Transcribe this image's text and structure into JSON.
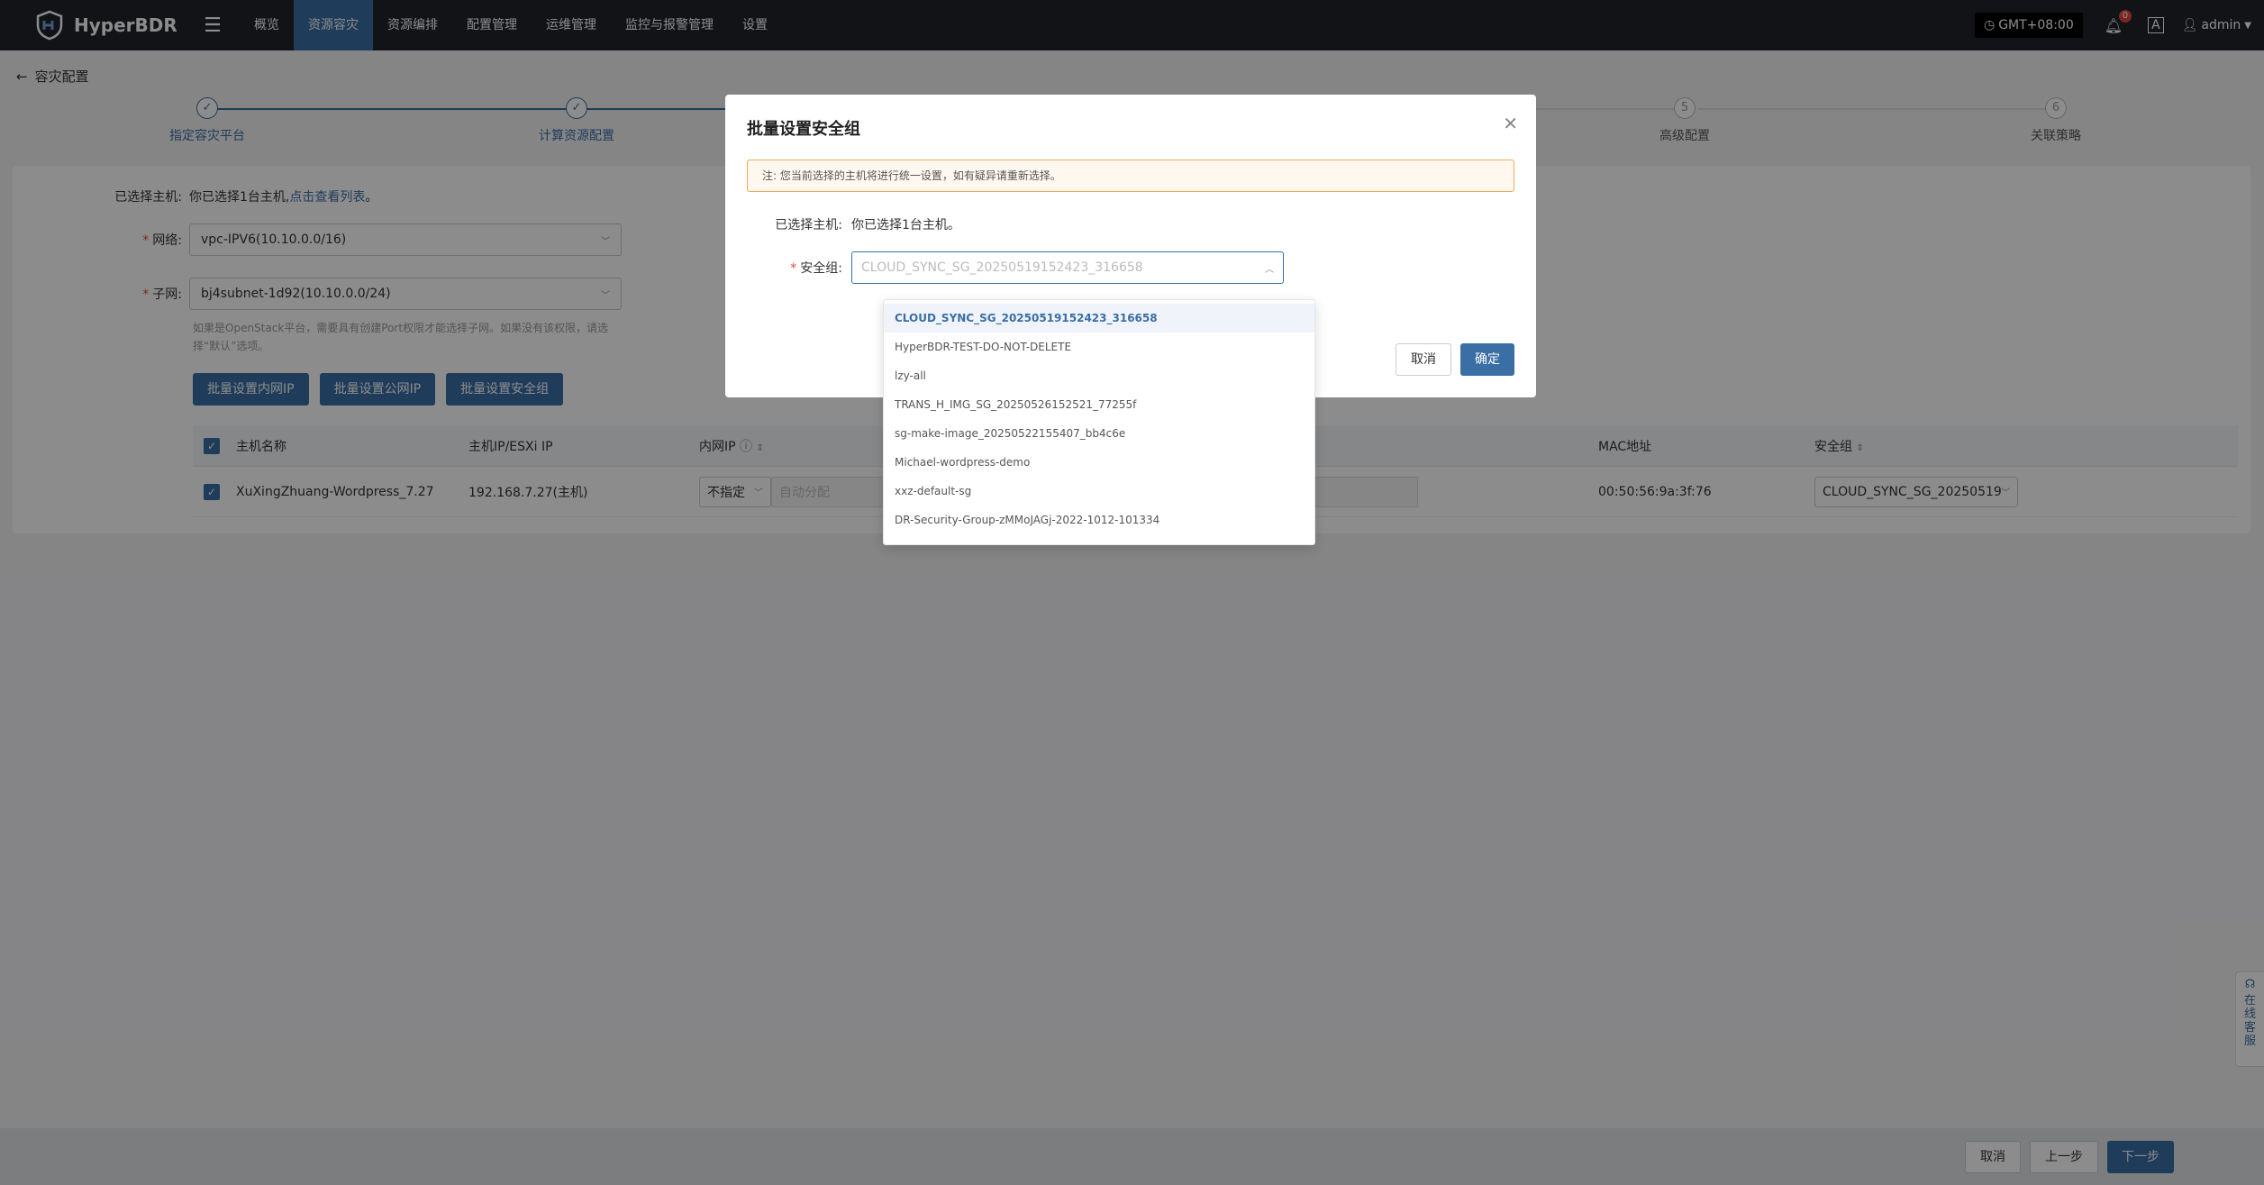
{
  "topbar": {
    "brand": "HyperBDR",
    "nav": [
      "概览",
      "资源容灾",
      "资源编排",
      "配置管理",
      "运维管理",
      "监控与报警管理",
      "设置"
    ],
    "active_index": 1,
    "timezone": "GMT+08:00",
    "notifications": "0",
    "lang_icon": "A",
    "user": "admin"
  },
  "page": {
    "title": "容灾配置"
  },
  "steps": [
    {
      "num": "1",
      "label": "指定容灾平台",
      "done": true
    },
    {
      "num": "2",
      "label": "计算资源配置",
      "done": true
    },
    {
      "num": "5",
      "label": "高级配置",
      "done": false
    },
    {
      "num": "6",
      "label": "关联策略",
      "done": false
    }
  ],
  "form": {
    "selected_label": "已选择主机:",
    "selected_text": "你已选择1台主机,",
    "view_list_link": "点击查看列表",
    "view_list_suffix": "。",
    "network_label": "网络:",
    "network_value": "vpc-IPV6(10.10.0.0/16)",
    "subnet_label": "子网:",
    "subnet_value": "bj4subnet-1d92(10.10.0.0/24)",
    "hint": "如果是OpenStack平台，需要具有创建Port权限才能选择子网。如果没有该权限，请选择“默认”选项。",
    "btn_private_ip": "批量设置内网IP",
    "btn_public_ip": "批量设置公网IP",
    "btn_security_group": "批量设置安全组"
  },
  "table": {
    "headers": {
      "host": "主机名称",
      "ip": "主机IP/ESXi IP",
      "private_ip": "内网IP",
      "mac": "MAC地址",
      "sg": "安全组"
    },
    "row": {
      "host": "XuXingZhuang-Wordpress_7.27",
      "ip": "192.168.7.27(主机)",
      "ip_mode": "不指定",
      "ip_placeholder": "自动分配",
      "mac": "00:50:56:9a:3f:76",
      "sg": "CLOUD_SYNC_SG_20250519"
    }
  },
  "modal": {
    "title": "批量设置安全组",
    "notice": "注: 您当前选择的主机将进行统一设置，如有疑异请重新选择。",
    "selected_label": "已选择主机:",
    "selected_text": "你已选择1台主机。",
    "sg_label": "安全组:",
    "sg_placeholder": "CLOUD_SYNC_SG_20250519152423_316658",
    "cancel": "取消",
    "confirm": "确定"
  },
  "dropdown": {
    "items": [
      "CLOUD_SYNC_SG_20250519152423_316658",
      "HyperBDR-TEST-DO-NOT-DELETE",
      "lzy-all",
      "TRANS_H_IMG_SG_20250526152521_77255f",
      "sg-make-image_20250522155407_bb4c6e",
      "Michael-wordpress-demo",
      "xxz-default-sg",
      "DR-Security-Group-zMMoJAGj-2022-1012-101334"
    ],
    "selected_index": 0
  },
  "footer": {
    "cancel": "取消",
    "prev": "上一步",
    "next": "下一步"
  },
  "side_help": [
    "在",
    "线",
    "客",
    "服"
  ],
  "colors": {
    "primary": "#3a6ea5",
    "topbar": "#1f2329",
    "warning_border": "#f0a85a"
  }
}
